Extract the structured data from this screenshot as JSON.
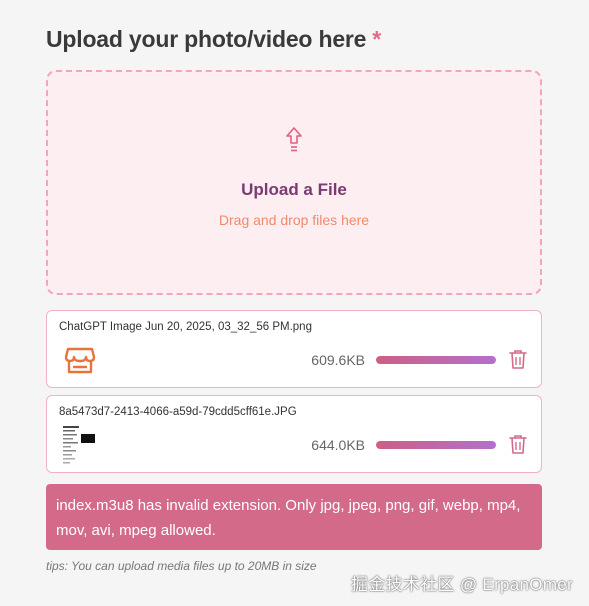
{
  "form": {
    "title": "Upload your photo/video here",
    "required_mark": "*"
  },
  "dropzone": {
    "icon": "upload-arrow-icon",
    "title": "Upload a File",
    "subtitle": "Drag and drop files here"
  },
  "files": [
    {
      "name": "ChatGPT Image Jun 20, 2025, 03_32_56 PM.png",
      "size": "609.6KB",
      "progress": 1.0,
      "thumb_icon": "store-icon",
      "action_icon": "trash-icon"
    },
    {
      "name": "8a5473d7-2413-4066-a59d-79cdd5cff61e.JPG",
      "size": "644.0KB",
      "progress": 1.0,
      "thumb_icon": "document-thumbnail",
      "action_icon": "trash-icon"
    }
  ],
  "error": {
    "message": "index.m3u8 has invalid extension. Only jpg, jpeg, png, gif, webp, mp4, mov, avi, mpeg allowed."
  },
  "tips": "tips: You can upload media files up to 20MB in size",
  "watermark": "掘金技术社区 @ ErpanOmer",
  "colors": {
    "accent": "#d46a8a",
    "dropzone_bg": "#fdeef2",
    "dropzone_border": "#f0a7ba",
    "dropzone_title": "#7a3a72",
    "dropzone_subtitle": "#ef8a6a",
    "progress_start": "#cc5f86",
    "progress_end": "#b470cc"
  }
}
